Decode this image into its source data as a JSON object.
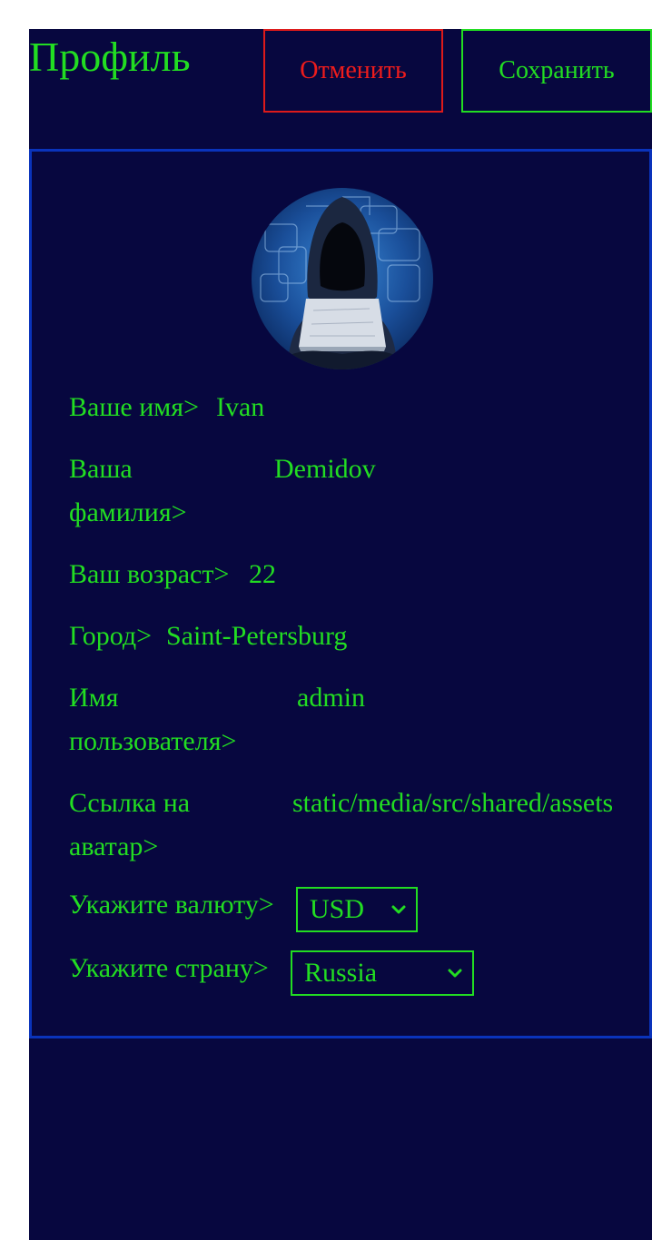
{
  "header": {
    "title": "Профиль",
    "cancel_label": "Отменить",
    "save_label": "Сохранить"
  },
  "colors": {
    "background": "#07073f",
    "accent_green": "#22dd22",
    "cancel_red": "#ee1c1c",
    "card_border": "#0a33bb"
  },
  "avatar": {
    "icon": "hacker-avatar-icon"
  },
  "profile": {
    "first_name": {
      "label": "Ваше имя>",
      "value": "Ivan"
    },
    "last_name": {
      "label_line1": "Ваша",
      "label_line2": "фамилия>",
      "value": "Demidov"
    },
    "age": {
      "label": "Ваш возраст>",
      "value": "22"
    },
    "city": {
      "label": "Город>",
      "value": "Saint-Petersburg"
    },
    "username": {
      "label_line1": "Имя",
      "label_line2": "пользователя>",
      "value": "admin"
    },
    "avatar_link": {
      "label_line1": "Ссылка на",
      "label_line2": "аватар>",
      "value": "static/media/src/shared/assets"
    },
    "currency": {
      "label": "Укажите валюту>",
      "value": "USD"
    },
    "country": {
      "label": "Укажите страну>",
      "value": "Russia"
    }
  }
}
